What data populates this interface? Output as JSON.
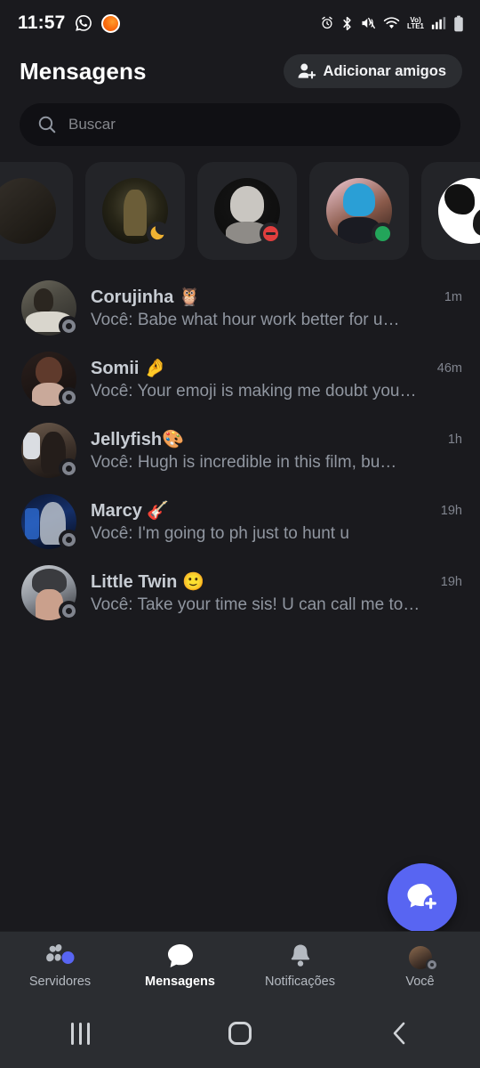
{
  "statusbar": {
    "time": "11:57",
    "left_icons": [
      "whatsapp-icon",
      "orange-app-icon"
    ],
    "right_icons": [
      "alarm-icon",
      "bluetooth-icon",
      "volume-mute-icon",
      "wifi-icon",
      "volte-icon",
      "signal-icon",
      "battery-icon"
    ],
    "volte_top": "Vo)",
    "volte_bottom": "LTE1"
  },
  "header": {
    "title": "Mensagens",
    "add_friends_label": "Adicionar amigos"
  },
  "search": {
    "placeholder": "Buscar"
  },
  "active_now": {
    "cards": [
      {
        "name": "card-partial-left",
        "status": "none",
        "art": "c-edge",
        "partial": true
      },
      {
        "name": "card-witch",
        "status": "idle",
        "art": "c-witch",
        "partial": false
      },
      {
        "name": "card-gray-portrait",
        "status": "dnd",
        "art": "c-gray",
        "partial": false
      },
      {
        "name": "card-blue-hair",
        "status": "online",
        "art": "c-blue",
        "partial": false
      },
      {
        "name": "card-manga",
        "status": "dnd",
        "art": "c-manga",
        "partial": false
      },
      {
        "name": "card-partial-right",
        "status": "none",
        "art": "c-edge",
        "partial": true
      }
    ]
  },
  "dms": [
    {
      "name": "Corujinha 🦉",
      "message": "Você: Babe what hour work better for u…",
      "time": "1m",
      "status": "offline",
      "art": "a-corujinha"
    },
    {
      "name": "Somii 🤌",
      "message": "Você: Your emoji is making me doubt you…",
      "time": "46m",
      "status": "offline",
      "art": "a-somii"
    },
    {
      "name": "Jellyfish🎨",
      "message": "Você: Hugh is incredible in this film, bu…",
      "time": "1h",
      "status": "offline",
      "art": "a-jelly"
    },
    {
      "name": "Marcy 🎸",
      "message": "Você: I'm going to ph just to hunt u",
      "time": "19h",
      "status": "offline",
      "art": "a-marcy"
    },
    {
      "name": "Little Twin 🙂",
      "message": "Você: Take your time sis! U can call me to…",
      "time": "19h",
      "status": "offline",
      "art": "a-twin"
    }
  ],
  "fab": {
    "icon": "new-message-icon"
  },
  "bottomnav": {
    "items": [
      {
        "label": "Servidores",
        "icon": "servers-icon",
        "active": false,
        "badge": true
      },
      {
        "label": "Mensagens",
        "icon": "messages-icon",
        "active": true,
        "badge": false
      },
      {
        "label": "Notificações",
        "icon": "bell-icon",
        "active": false,
        "badge": false
      },
      {
        "label": "Você",
        "icon": "profile-avatar-icon",
        "active": false,
        "badge": false
      }
    ]
  },
  "gesturebar": {
    "recents": "recents-icon",
    "home": "home-icon",
    "back": "back-icon"
  },
  "colors": {
    "background": "#1a1a1e",
    "surface": "#232428",
    "navbar": "#2b2d31",
    "search": "#101014",
    "accent": "#5865f2",
    "online": "#23a55a",
    "dnd": "#e03e3e",
    "idle": "#f0b232",
    "offline": "#80848e",
    "text_primary": "#ffffff",
    "text_secondary": "#9096a0",
    "text_muted": "#80848e"
  }
}
